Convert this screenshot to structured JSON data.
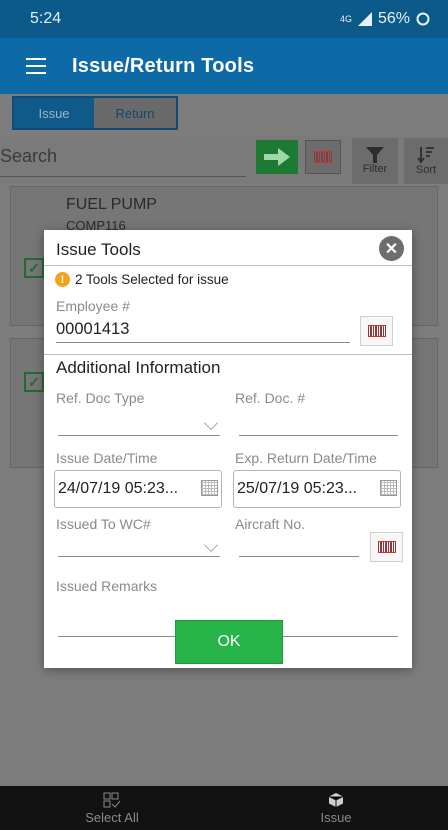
{
  "status_bar": {
    "time": "5:24",
    "network": "4G",
    "battery": "56%"
  },
  "app_bar": {
    "title": "Issue/Return Tools"
  },
  "tabs": [
    {
      "label": "Issue"
    },
    {
      "label": "Return"
    }
  ],
  "search": {
    "placeholder": "Search"
  },
  "toolbar": {
    "filter_label": "Filter",
    "sort_label": "Sort"
  },
  "items": [
    {
      "title": "FUEL PUMP",
      "code": "COMP116"
    }
  ],
  "bottom_nav": {
    "select_all": "Select All",
    "issue": "Issue"
  },
  "dialog": {
    "title": "Issue Tools",
    "warning": "2 Tools Selected for issue",
    "employee_label": "Employee #",
    "employee_value": "00001413",
    "section_title": "Additional Information",
    "ref_doc_type_label": "Ref. Doc Type",
    "ref_doc_no_label": "Ref. Doc. #",
    "issue_datetime_label": "Issue Date/Time",
    "issue_datetime_value": "24/07/19 05:23...",
    "exp_return_label": "Exp. Return Date/Time",
    "exp_return_value": "25/07/19 05:23...",
    "issued_to_wc_label": "Issued To WC#",
    "aircraft_label": "Aircraft No.",
    "remarks_label": "Issued Remarks",
    "ok_label": "OK"
  },
  "colors": {
    "primary": "#0e6aa7",
    "status_bar": "#0b5a8a",
    "ok_button": "#27b54a",
    "warning": "#f3a31b"
  }
}
